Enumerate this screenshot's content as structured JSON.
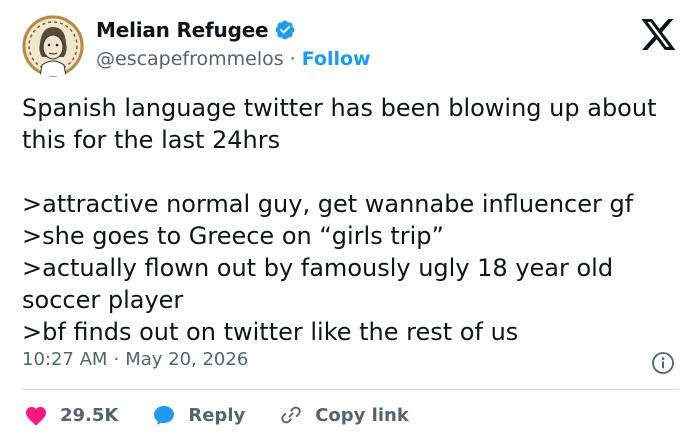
{
  "author": {
    "display_name": "Melian Refugee",
    "handle": "@escapefrommelos",
    "separator": "·",
    "follow_label": "Follow"
  },
  "tweet": {
    "text": "Spanish language twitter has been blowing up about this for the last 24hrs\n\n>attractive normal guy, get wannabe influencer gf\n>she goes to Greece on “girls trip”\n>actually flown out by famously ugly 18 year old soccer player\n>bf finds out on twitter like the rest of us",
    "time": "10:27 AM",
    "separator": "·",
    "date": "May 20, 2026"
  },
  "actions": {
    "likes_count": "29.5K",
    "reply_label": "Reply",
    "copy_link_label": "Copy link"
  },
  "icons": {
    "verified": "verified-badge-icon",
    "brand": "x-logo-icon",
    "info": "info-icon",
    "like": "heart-icon",
    "reply": "speech-bubble-icon",
    "copy_link": "link-icon"
  },
  "colors": {
    "accent": "#1d9bf0",
    "like": "#f91880",
    "text": "#0f1419",
    "muted": "#536471",
    "divider": "#cfd9de"
  }
}
